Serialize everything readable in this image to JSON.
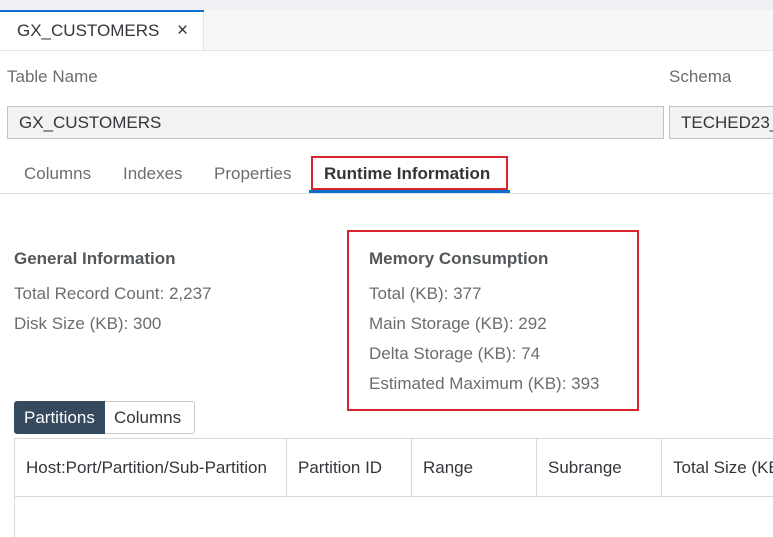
{
  "doc_tab": {
    "label": "GX_CUSTOMERS",
    "close_glyph": "×"
  },
  "table_name": {
    "label": "Table Name",
    "value": "GX_CUSTOMERS"
  },
  "schema": {
    "label": "Schema",
    "value": "TECHED23_"
  },
  "subtabs": [
    "Columns",
    "Indexes",
    "Properties",
    "Runtime Information"
  ],
  "active_subtab": "Runtime Information",
  "general": {
    "title": "General Information",
    "total_record_count": "Total Record Count: 2,237",
    "disk_size": "Disk Size (KB): 300"
  },
  "memory": {
    "title": "Memory Consumption",
    "total": "Total (KB): 377",
    "main_storage": "Main Storage (KB): 292",
    "delta_storage": "Delta Storage (KB): 74",
    "estimated_maximum": "Estimated Maximum (KB): 393"
  },
  "view_toggle": {
    "selected": "Partitions",
    "other": "Columns"
  },
  "partitions_table": {
    "columns": [
      "Host:Port/Partition/Sub-Partition",
      "Partition ID",
      "Range",
      "Subrange",
      "Total Size (KB)"
    ]
  },
  "colors": {
    "accent": "#0a6ed1",
    "highlight_red": "#d9232e",
    "segment_active": "#354a5f"
  }
}
